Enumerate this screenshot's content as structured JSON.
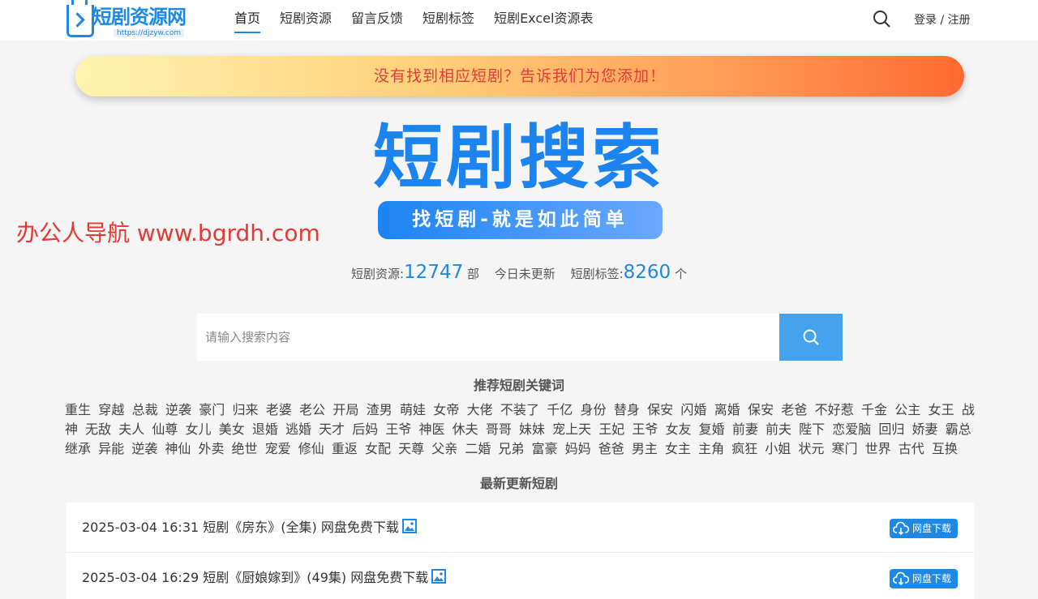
{
  "header": {
    "logo_text": "短剧资源网",
    "logo_url": "https://djzyw.com",
    "nav": [
      "首页",
      "短剧资源",
      "留言反馈",
      "短剧标签",
      "短剧Excel资源表"
    ],
    "auth": "登录 / 注册"
  },
  "banner": {
    "text": "没有找到相应短剧？告诉我们为您添加！"
  },
  "hero": {
    "title": "短剧搜索",
    "subtitle": "找短剧-就是如此简单"
  },
  "watermark": "办公人导航 www.bgrdh.com",
  "stats": {
    "resources_label": "短剧资源:",
    "resources_count": "12747",
    "resources_unit": "部",
    "today_text": "今日未更新",
    "tags_label": "短剧标签:",
    "tags_count": "8260",
    "tags_unit": "个"
  },
  "search": {
    "placeholder": "请输入搜索内容"
  },
  "keywords_section": {
    "title": "推荐短剧关键词",
    "items": [
      "重生",
      "穿越",
      "总裁",
      "逆袭",
      "豪门",
      "归来",
      "老婆",
      "老公",
      "开局",
      "渣男",
      "萌娃",
      "女帝",
      "大佬",
      "不装了",
      "千亿",
      "身份",
      "替身",
      "保安",
      "闪婚",
      "离婚",
      "保安",
      "老爸",
      "不好惹",
      "千金",
      "公主",
      "女王",
      "战神",
      "无敌",
      "夫人",
      "仙尊",
      "女儿",
      "美女",
      "退婚",
      "逃婚",
      "天才",
      "后妈",
      "王爷",
      "神医",
      "休夫",
      "哥哥",
      "妹妹",
      "宠上天",
      "王妃",
      "王爷",
      "女友",
      "复婚",
      "前妻",
      "前夫",
      "陛下",
      "恋爱脑",
      "回归",
      "娇妻",
      "霸总",
      "继承",
      "异能",
      "逆袭",
      "神仙",
      "外卖",
      "绝世",
      "宠爱",
      "修仙",
      "重返",
      "女配",
      "天尊",
      "父亲",
      "二婚",
      "兄弟",
      "富豪",
      "妈妈",
      "爸爸",
      "男主",
      "女主",
      "主角",
      "疯狂",
      "小姐",
      "状元",
      "寒门",
      "世界",
      "古代",
      "互换"
    ]
  },
  "latest_section": {
    "title": "最新更新短剧",
    "rows": [
      {
        "text": "2025-03-04 16:31 短剧《房东》(全集) 网盘免费下载",
        "button": "网盘下载"
      },
      {
        "text": "2025-03-04 16:29 短剧《厨娘嫁到》(49集) 网盘免费下载",
        "button": "网盘下载"
      }
    ]
  },
  "colors": {
    "accent": "#1e88e5",
    "banner_text": "#e83a3a",
    "watermark": "#e53935",
    "search_button": "#44a3ec"
  }
}
